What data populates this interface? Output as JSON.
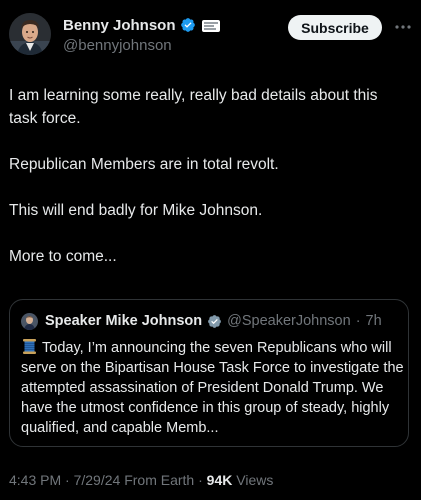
{
  "author": {
    "display_name": "Benny Johnson",
    "handle": "@bennyjohnson",
    "verified_icon": "verified-badge-icon",
    "affiliate_icon": "affiliate-badge-icon"
  },
  "actions": {
    "subscribe_label": "Subscribe",
    "more_icon": "more-horizontal-icon"
  },
  "tweet": {
    "paragraphs": [
      "I am learning some really, really bad details about this task force.",
      "Republican Members are in total revolt.",
      "This will end badly for Mike Johnson.",
      "More to come..."
    ]
  },
  "quote": {
    "display_name": "Speaker Mike Johnson",
    "handle": "@SpeakerJohnson",
    "separator": "·",
    "time": "7h",
    "emoji_icon": "spool-of-thread-icon",
    "text": "Today, I’m announcing the seven Republicans who will serve on the Bipartisan House Task Force to investigate the attempted assassination of President Donald Trump. We have the utmost confidence in this group of steady, highly qualified, and capable Memb..."
  },
  "meta": {
    "time": "4:43 PM",
    "sep1": "·",
    "date": "7/29/24",
    "source": "From Earth",
    "sep2": "·",
    "views_count": "94K",
    "views_label": "Views"
  },
  "colors": {
    "background": "#000000",
    "text_primary": "#e7e9ea",
    "text_secondary": "#71767b",
    "verified_blue": "#1d9bf0",
    "border": "#2f3336"
  }
}
